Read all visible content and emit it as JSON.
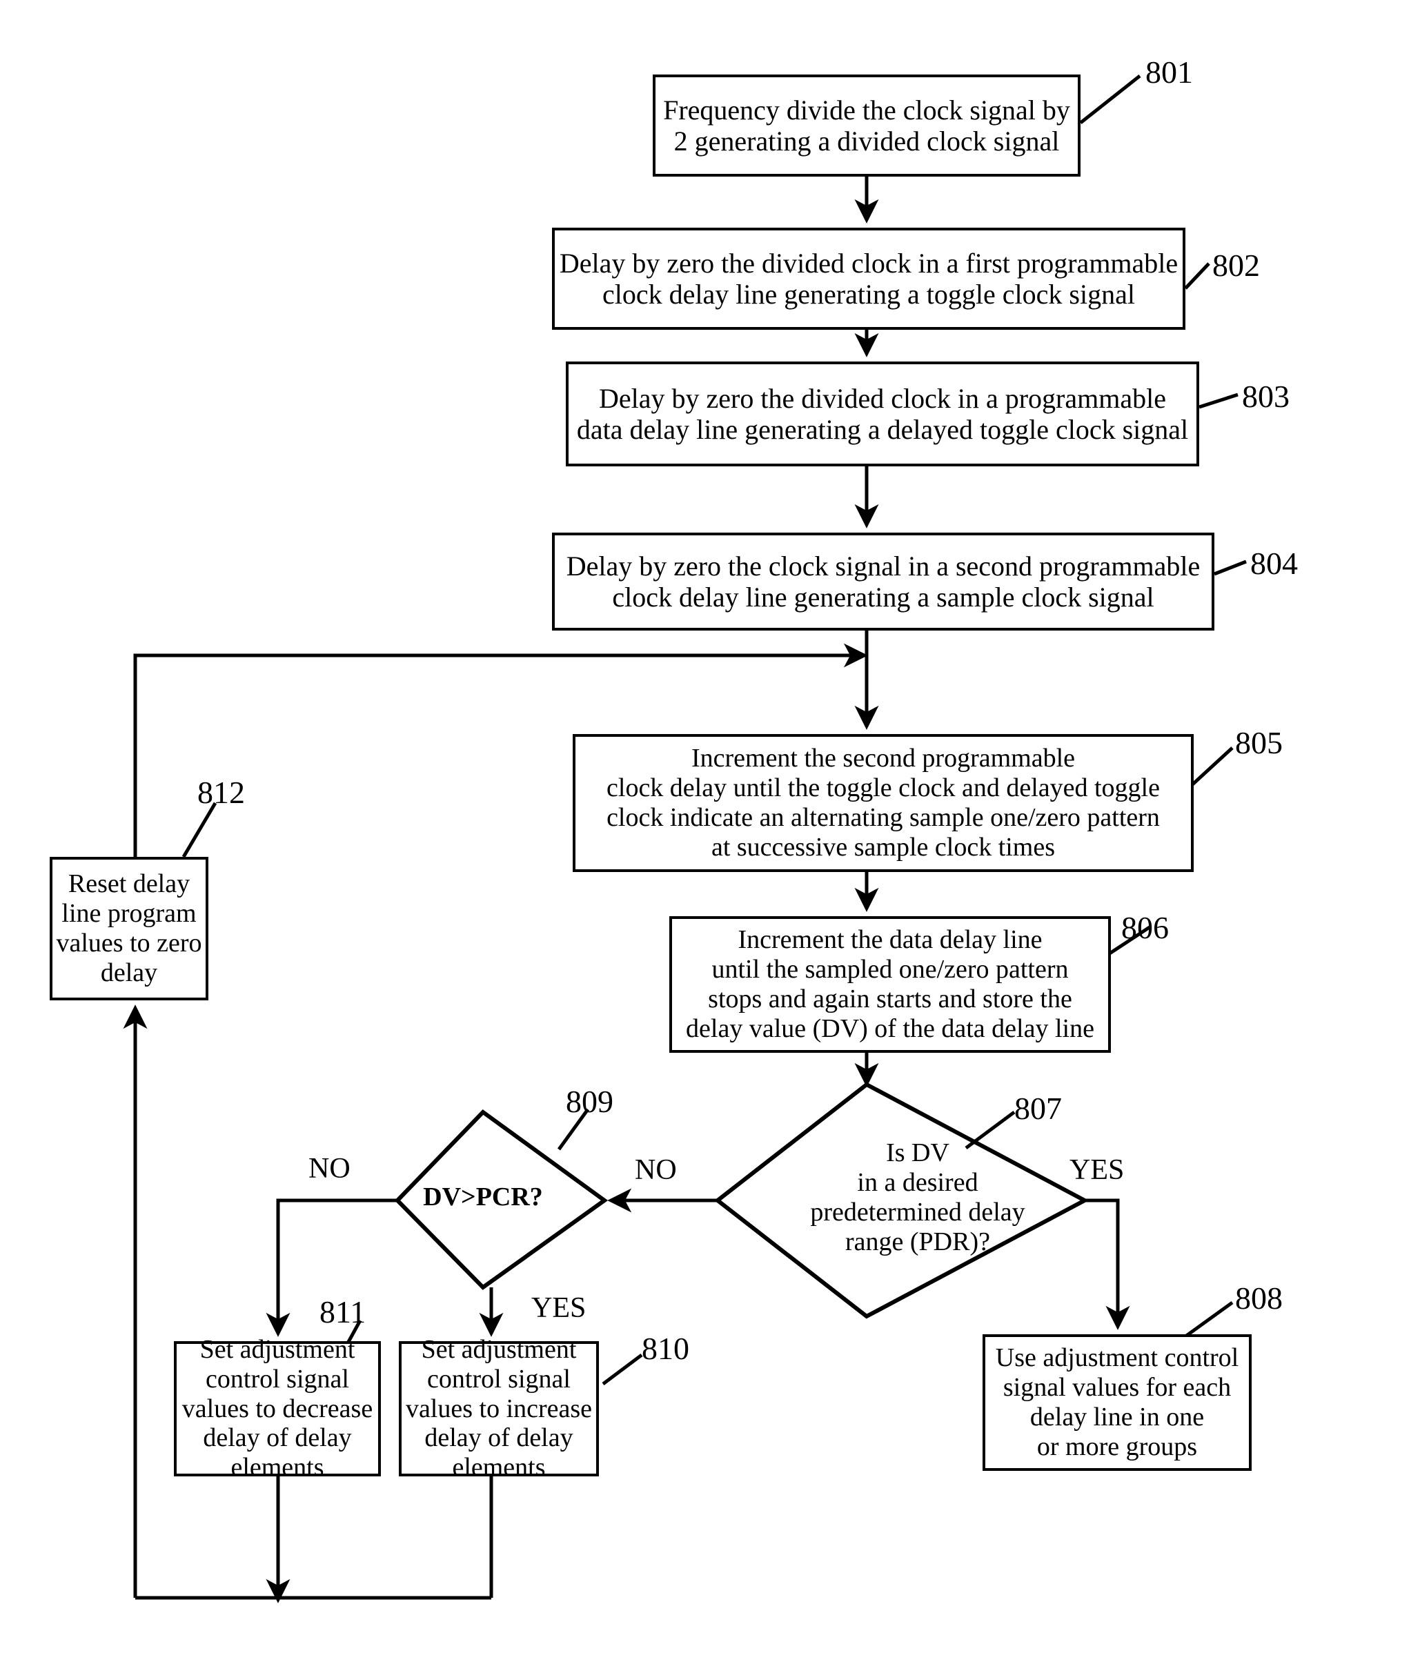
{
  "figure": {
    "type": "flowchart",
    "orientation": "top-to-bottom-with-feedback"
  },
  "nodes": {
    "n801": {
      "ref": "801",
      "shape": "process",
      "lines": [
        "Frequency divide the clock signal by",
        "2 generating a divided clock  signal"
      ]
    },
    "n802": {
      "ref": "802",
      "shape": "process",
      "lines": [
        "Delay by zero the divided clock in a first programmable",
        "clock delay line generating a toggle clock signal"
      ]
    },
    "n803": {
      "ref": "803",
      "shape": "process",
      "lines": [
        "Delay by zero the divided clock in a programmable",
        "data delay line generating a delayed toggle clock signal"
      ]
    },
    "n804": {
      "ref": "804",
      "shape": "process",
      "lines": [
        "Delay by zero  the clock signal in a second programmable",
        "clock delay line generating a sample clock signal"
      ]
    },
    "n805": {
      "ref": "805",
      "shape": "process",
      "lines": [
        "Increment the second programmable",
        "clock delay until  the toggle clock and delayed toggle",
        "clock indicate an alternating sample one/zero pattern",
        "at successive sample clock times"
      ]
    },
    "n806": {
      "ref": "806",
      "shape": "process",
      "lines": [
        "Increment the data delay line",
        "until the sampled one/zero  pattern",
        "stops and again starts and store the",
        "delay value (DV) of the data delay line"
      ]
    },
    "n807": {
      "ref": "807",
      "shape": "decision",
      "lines": [
        "Is DV",
        "in a desired",
        "predetermined delay",
        "range (PDR)?"
      ]
    },
    "n808": {
      "ref": "808",
      "shape": "process",
      "lines": [
        "Use adjustment control",
        "signal values for each",
        "delay line in one",
        "or more groups"
      ]
    },
    "n809": {
      "ref": "809",
      "shape": "decision",
      "lines": [
        "DV>PCR?"
      ]
    },
    "n810": {
      "ref": "810",
      "shape": "process",
      "lines": [
        "Set adjustment",
        "control signal",
        "values to increase",
        "delay of delay",
        "elements"
      ]
    },
    "n811": {
      "ref": "811",
      "shape": "process",
      "lines": [
        "Set adjustment",
        "control signal",
        "values to decrease",
        "delay of delay",
        "elements"
      ]
    },
    "n812": {
      "ref": "812",
      "shape": "process",
      "lines": [
        "Reset delay",
        "line program",
        "values to zero",
        "delay"
      ]
    }
  },
  "edge_labels": {
    "yes_807": "YES",
    "no_807": "NO",
    "no_809": "NO",
    "yes_809": "YES"
  },
  "colors": {
    "stroke": "#000000",
    "fill": "#ffffff",
    "text": "#000000"
  }
}
